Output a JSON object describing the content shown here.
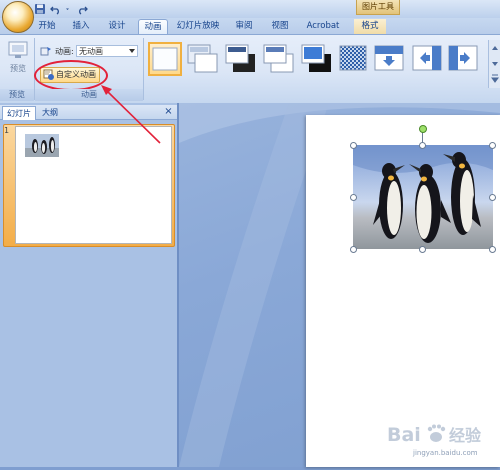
{
  "window": {
    "context_tab_title": "图片工具"
  },
  "tabs": [
    {
      "label": "开始"
    },
    {
      "label": "插入"
    },
    {
      "label": "设计"
    },
    {
      "label": "动画",
      "active": true
    },
    {
      "label": "幻灯片放映"
    },
    {
      "label": "审阅"
    },
    {
      "label": "视图"
    },
    {
      "label": "Acrobat"
    },
    {
      "label": "格式",
      "contextual": true
    }
  ],
  "ribbon": {
    "preview": {
      "label": "预览",
      "group_label": "预览"
    },
    "animation": {
      "group_label": "动画",
      "field_label": "动画:",
      "selected_value": "无动画",
      "custom_button_label": "自定义动画"
    }
  },
  "left_pane": {
    "tabs": [
      {
        "label": "幻灯片"
      },
      {
        "label": "大纲"
      }
    ],
    "close": "×",
    "slide_number": "1"
  },
  "watermark": {
    "text": "Baidu经验",
    "sub": "jingyan.baidu.com"
  },
  "colors": {
    "accent_blue": "#15428b",
    "annotation_red": "#e2223a",
    "thumb_selected": "#f3ad48",
    "slide_background": "#ffffff"
  }
}
